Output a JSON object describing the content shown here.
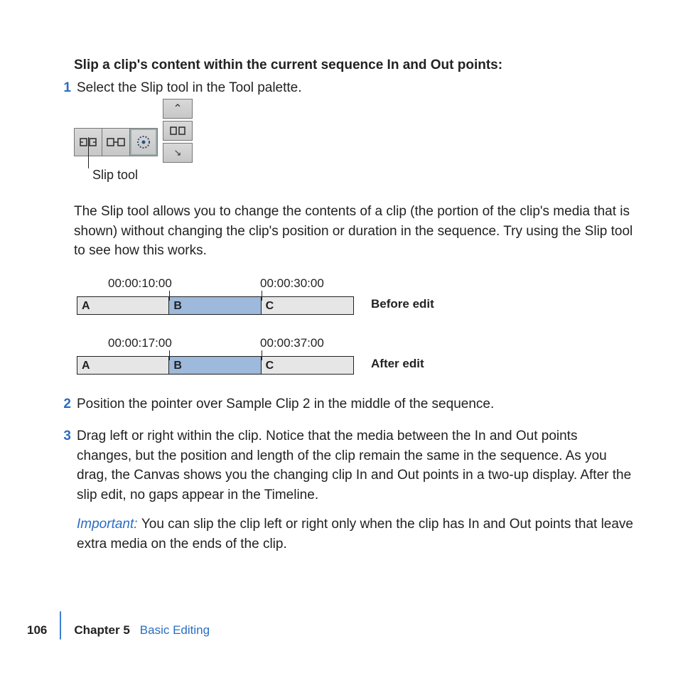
{
  "heading": "Slip a clip's content within the current sequence In and Out points:",
  "steps": {
    "n1": "1",
    "s1": "Select the Slip tool in the Tool palette.",
    "n2": "2",
    "s2": "Position the pointer over Sample Clip 2 in the middle of the sequence.",
    "n3": "3",
    "s3": "Drag left or right within the clip. Notice that the media between the In and Out points changes, but the position and length of the clip remain the same in the sequence. As you drag, the Canvas shows you the changing clip In and Out points in a two-up display. After the slip edit, no gaps appear in the Timeline."
  },
  "toolpalette": {
    "callout": "Slip tool"
  },
  "paragraph": "The Slip tool allows you to change the contents of a clip (the portion of the clip's media that is shown) without changing the clip's position or duration in the sequence. Try using the Slip tool to see how this works.",
  "diagram": {
    "before": {
      "tc_in": "00:00:10:00",
      "tc_out": "00:00:30:00",
      "a": "A",
      "b": "B",
      "c": "C",
      "label": "Before edit"
    },
    "after": {
      "tc_in": "00:00:17:00",
      "tc_out": "00:00:37:00",
      "a": "A",
      "b": "B",
      "c": "C",
      "label": "After edit"
    }
  },
  "important": {
    "label": "Important:  ",
    "text": "You can slip the clip left or right only when the clip has In and Out points that leave extra media on the ends of the clip."
  },
  "footer": {
    "page": "106",
    "chapter_label": "Chapter 5",
    "chapter_title": "Basic Editing"
  }
}
